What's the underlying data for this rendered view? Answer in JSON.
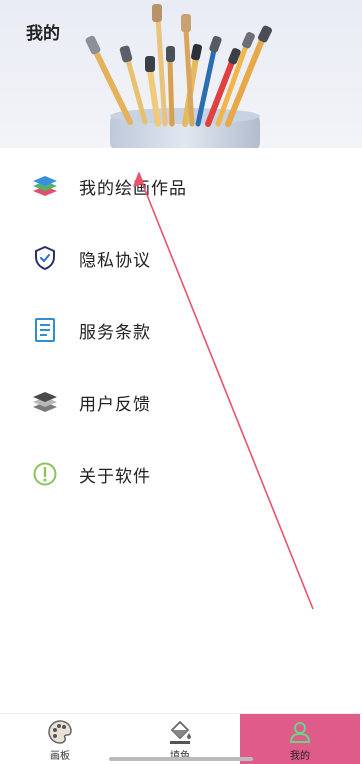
{
  "header": {
    "title": "我的"
  },
  "menu": {
    "items": [
      {
        "label": "我的绘画作品",
        "icon": "layers-color-icon"
      },
      {
        "label": "隐私协议",
        "icon": "shield-check-icon"
      },
      {
        "label": "服务条款",
        "icon": "document-list-icon"
      },
      {
        "label": "用户反馈",
        "icon": "layers-gray-icon"
      },
      {
        "label": "关于软件",
        "icon": "info-circle-icon"
      }
    ]
  },
  "bottom_nav": {
    "tabs": [
      {
        "label": "画板",
        "icon": "palette-icon",
        "active": false
      },
      {
        "label": "填色",
        "icon": "paint-bucket-icon",
        "active": false
      },
      {
        "label": "我的",
        "icon": "person-icon",
        "active": true
      }
    ]
  },
  "colors": {
    "active_tab": "#df5b8a",
    "annotation_arrow": "#e8546b",
    "shield": "#2b2d6e",
    "document": "#2f8fd0",
    "info": "#8cc45b"
  }
}
